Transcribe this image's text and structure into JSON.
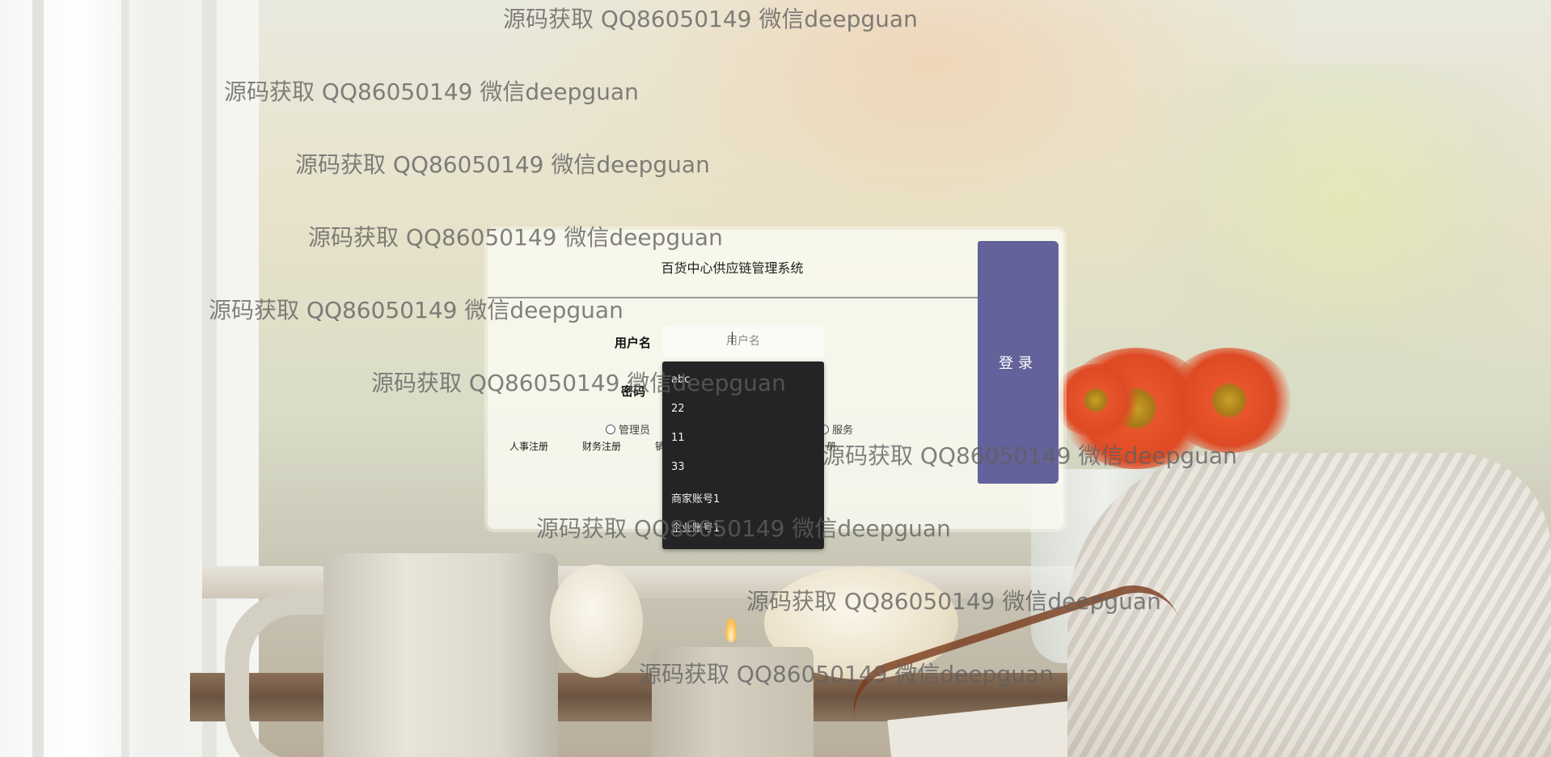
{
  "watermark_text": "源码获取 QQ86050149 微信deepguan",
  "login": {
    "system_title": "百货中心供应链管理系统",
    "username_label": "用户名",
    "username_placeholder": "用户名",
    "password_label": "密码",
    "login_button": "登录",
    "roles": [
      "管理员",
      "服务"
    ],
    "register_links": [
      "人事注册",
      "财务注册",
      "销",
      "册"
    ]
  },
  "autocomplete": {
    "items": [
      "abc",
      "22",
      "11",
      "33",
      "商家账号1",
      "企业账号1"
    ]
  },
  "colors": {
    "login_button": "#63629a",
    "dropdown_bg": "#242426",
    "card_bg": "#fbfbf3"
  }
}
